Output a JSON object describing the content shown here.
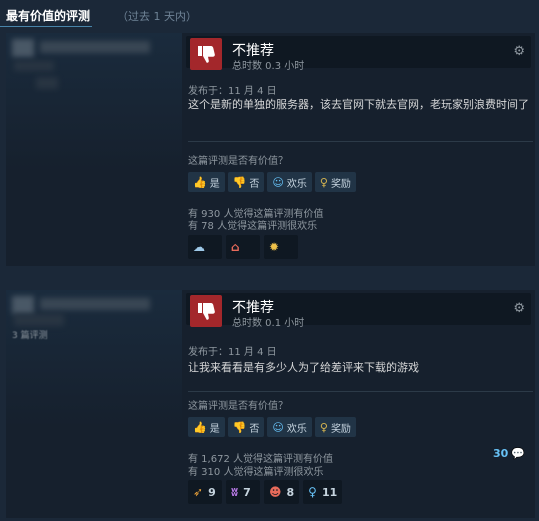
{
  "header": {
    "title": "最有价值的评测",
    "subtitle": "（过去 1 天内）"
  },
  "reviews": [
    {
      "verdict": "不推荐",
      "hours": "总时数 0.3 小时",
      "posted": "发布于：11 月 4 日",
      "text": "这个是新的单独的服务器，该去官网下就去官网，老玩家别浪费时间了",
      "helpful_question": "这篇评测是否有价值？",
      "buttons": {
        "yes": "是",
        "no": "否",
        "funny": "欢乐",
        "award": "奖励"
      },
      "helpful_count": "有 930 人觉得这篇评测有价值",
      "funny_count": "有 78 人觉得这篇评测很欢乐",
      "awards": [
        {
          "icon": "cloud-award-icon",
          "glyph": "☁",
          "color": "#9ec9e8",
          "count": ""
        },
        {
          "icon": "house-award-icon",
          "glyph": "⌂",
          "color": "#e86b5b",
          "count": ""
        },
        {
          "icon": "sun-award-icon",
          "glyph": "✹",
          "color": "#f0c24a",
          "count": ""
        }
      ]
    },
    {
      "verdict": "不推荐",
      "hours": "总时数 0.1 小时",
      "posted": "发布于：11 月 4 日",
      "text": "让我来看看是有多少人为了给差评来下载的游戏",
      "helpful_question": "这篇评测是否有价值？",
      "buttons": {
        "yes": "是",
        "no": "否",
        "funny": "欢乐",
        "award": "奖励"
      },
      "helpful_count": "有 1,672 人觉得这篇评测有价值",
      "funny_count": "有 310 人觉得这篇评测很欢乐",
      "comment_count": "30",
      "author_count_text": "3 篇评测",
      "awards": [
        {
          "icon": "horn-award-icon",
          "glyph": "➶",
          "color": "#e8a03a",
          "count": "9"
        },
        {
          "icon": "claws-award-icon",
          "glyph": "ʬ",
          "color": "#b87ae6",
          "count": "7"
        },
        {
          "icon": "face-award-icon",
          "glyph": "☻",
          "color": "#e86b5b",
          "count": "8"
        },
        {
          "icon": "medal-award-icon",
          "glyph": "♀",
          "color": "#67c1f5",
          "count": "11"
        }
      ]
    }
  ],
  "colors": {
    "background": "#1b2838",
    "thumb_down": "#a3272b",
    "accent": "#67c1f5"
  }
}
